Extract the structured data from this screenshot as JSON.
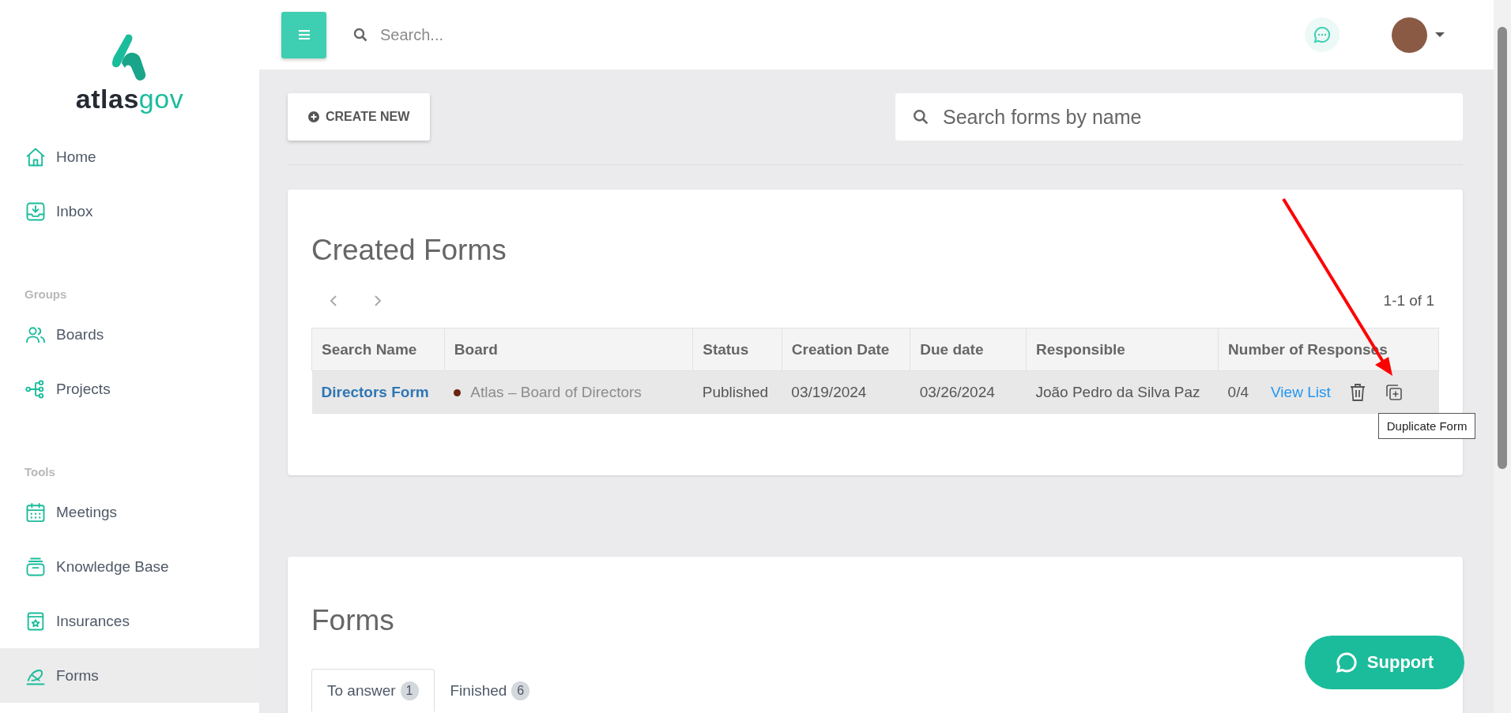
{
  "brand": {
    "part_1": "atlas",
    "part_2": "gov"
  },
  "sidebar": {
    "items": [
      {
        "kind": "link",
        "label": "Home",
        "selected": false
      },
      {
        "kind": "link",
        "label": "Inbox",
        "selected": false
      },
      {
        "kind": "section",
        "label": "Groups"
      },
      {
        "kind": "link",
        "label": "Boards",
        "selected": false
      },
      {
        "kind": "link",
        "label": "Projects",
        "selected": false
      },
      {
        "kind": "section",
        "label": "Tools"
      },
      {
        "kind": "link",
        "label": "Meetings",
        "selected": false
      },
      {
        "kind": "link",
        "label": "Knowledge Base",
        "selected": false
      },
      {
        "kind": "link",
        "label": "Insurances",
        "selected": false
      },
      {
        "kind": "link",
        "label": "Forms",
        "selected": true
      }
    ]
  },
  "topbar": {
    "search": {
      "placeholder": "Search..."
    }
  },
  "toolbar": {
    "create_button": "CREATE NEW",
    "search": {
      "placeholder": "Search forms by name"
    }
  },
  "created_forms": {
    "title": "Created Forms",
    "pagination": "1-1 of 1",
    "table": {
      "columns": [
        "Search Name",
        "Board",
        "Status",
        "Creation Date",
        "Due date",
        "Responsible",
        "Number of Responses"
      ],
      "rows": [
        {
          "name": "Directors Form",
          "board": "Atlas – Board of Directors",
          "color": "#6b2410",
          "status": "Published",
          "created": "03/19/2024",
          "due": "03/26/2024",
          "responsible": "João Pedro da Silva Paz",
          "responses": "0/4",
          "view_link": "View List",
          "tooltip": "Duplicate Form"
        }
      ]
    }
  },
  "forms": {
    "title": "Forms",
    "tabs": [
      {
        "label": "To answer",
        "count": "1",
        "selected": true
      },
      {
        "label": "Finished",
        "count": "6",
        "selected": false
      }
    ]
  },
  "support_button": "Support"
}
